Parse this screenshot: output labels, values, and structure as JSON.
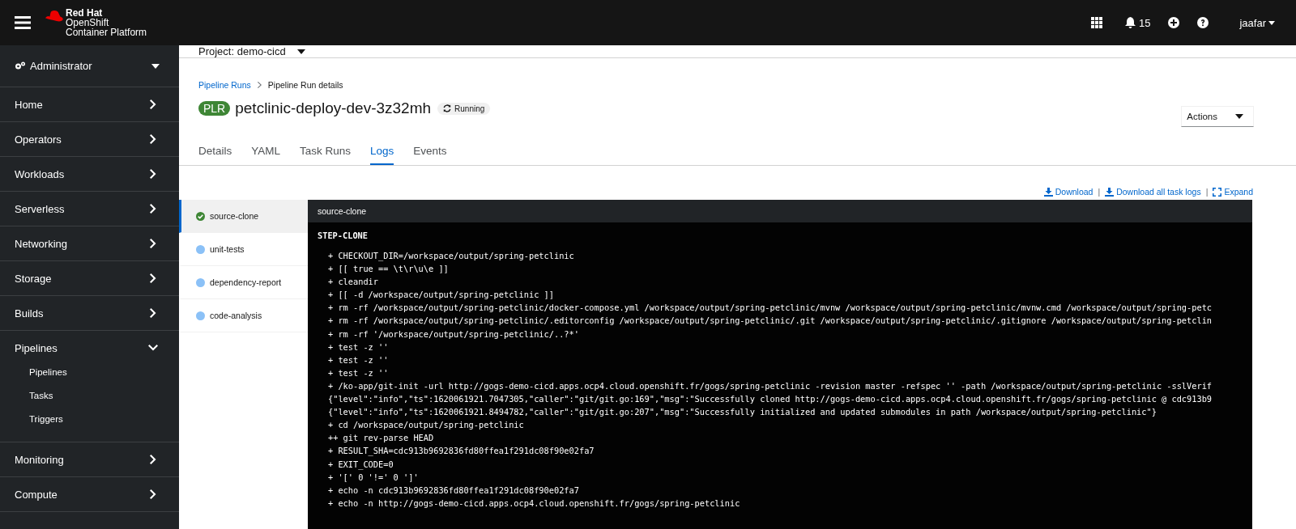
{
  "masthead": {
    "brand": [
      "Red Hat",
      "OpenShift",
      "Container Platform"
    ],
    "notifications": "15",
    "user": "jaafar"
  },
  "sidebar": {
    "perspective": "Administrator",
    "items": [
      {
        "label": "Home",
        "expanded": false
      },
      {
        "label": "Operators",
        "expanded": false
      },
      {
        "label": "Workloads",
        "expanded": false
      },
      {
        "label": "Serverless",
        "expanded": false
      },
      {
        "label": "Networking",
        "expanded": false
      },
      {
        "label": "Storage",
        "expanded": false
      },
      {
        "label": "Builds",
        "expanded": false
      },
      {
        "label": "Pipelines",
        "expanded": true,
        "children": [
          {
            "label": "Pipelines"
          },
          {
            "label": "Tasks"
          },
          {
            "label": "Triggers"
          }
        ]
      },
      {
        "label": "Monitoring",
        "expanded": false
      },
      {
        "label": "Compute",
        "expanded": false
      }
    ]
  },
  "project": "Project: demo-cicd",
  "breadcrumb": [
    "Pipeline Runs",
    "Pipeline Run details"
  ],
  "title": {
    "badge": "PLR",
    "name": "petclinic-deploy-dev-3z32mh",
    "status": "Running"
  },
  "actions": "Actions",
  "tabs": [
    {
      "label": "Details",
      "selected": false
    },
    {
      "label": "YAML",
      "selected": false
    },
    {
      "label": "Task Runs",
      "selected": false
    },
    {
      "label": "Logs",
      "selected": true
    },
    {
      "label": "Events",
      "selected": false
    }
  ],
  "log_links": [
    {
      "label": "Download",
      "kind": "download"
    },
    {
      "separator": "|",
      "label": "Download all task logs",
      "kind": "download"
    },
    {
      "separator": "|",
      "label": "Expand",
      "kind": "expand"
    }
  ],
  "tasks": [
    {
      "name": "source-clone",
      "kind": "succeeded",
      "selected": true
    },
    {
      "name": "unit-tests",
      "kind": "pending",
      "selected": false
    },
    {
      "name": "dependency-report",
      "kind": "pending",
      "selected": false
    },
    {
      "name": "code-analysis",
      "kind": "pending",
      "selected": false
    }
  ],
  "log": {
    "title": "source-clone",
    "step": "STEP-CLONE",
    "lines": [
      "+ CHECKOUT_DIR=/workspace/output/spring-petclinic",
      "+ [[ true == \\t\\r\\u\\e ]]",
      "+ cleandir",
      "+ [[ -d /workspace/output/spring-petclinic ]]",
      "+ rm -rf /workspace/output/spring-petclinic/docker-compose.yml /workspace/output/spring-petclinic/mvnw /workspace/output/spring-petclinic/mvnw.cmd /workspace/output/spring-petc",
      "+ rm -rf /workspace/output/spring-petclinic/.editorconfig /workspace/output/spring-petclinic/.git /workspace/output/spring-petclinic/.gitignore /workspace/output/spring-petclin",
      "+ rm -rf '/workspace/output/spring-petclinic/..?*'",
      "+ test -z ''",
      "+ test -z ''",
      "+ test -z ''",
      "+ /ko-app/git-init -url http://gogs-demo-cicd.apps.ocp4.cloud.openshift.fr/gogs/spring-petclinic -revision master -refspec '' -path /workspace/output/spring-petclinic -sslVerif",
      "{\"level\":\"info\",\"ts\":1620061921.7047305,\"caller\":\"git/git.go:169\",\"msg\":\"Successfully cloned http://gogs-demo-cicd.apps.ocp4.cloud.openshift.fr/gogs/spring-petclinic @ cdc913b9",
      "{\"level\":\"info\",\"ts\":1620061921.8494782,\"caller\":\"git/git.go:207\",\"msg\":\"Successfully initialized and updated submodules in path /workspace/output/spring-petclinic\"}",
      "+ cd /workspace/output/spring-petclinic",
      "++ git rev-parse HEAD",
      "+ RESULT_SHA=cdc913b9692836fd80ffea1f291dc08f90e02fa7",
      "+ EXIT_CODE=0",
      "+ '[' 0 '!=' 0 ']'",
      "+ echo -n cdc913b9692836fd80ffea1f291dc08f90e02fa7",
      "+ echo -n http://gogs-demo-cicd.apps.ocp4.cloud.openshift.fr/gogs/spring-petclinic"
    ]
  }
}
